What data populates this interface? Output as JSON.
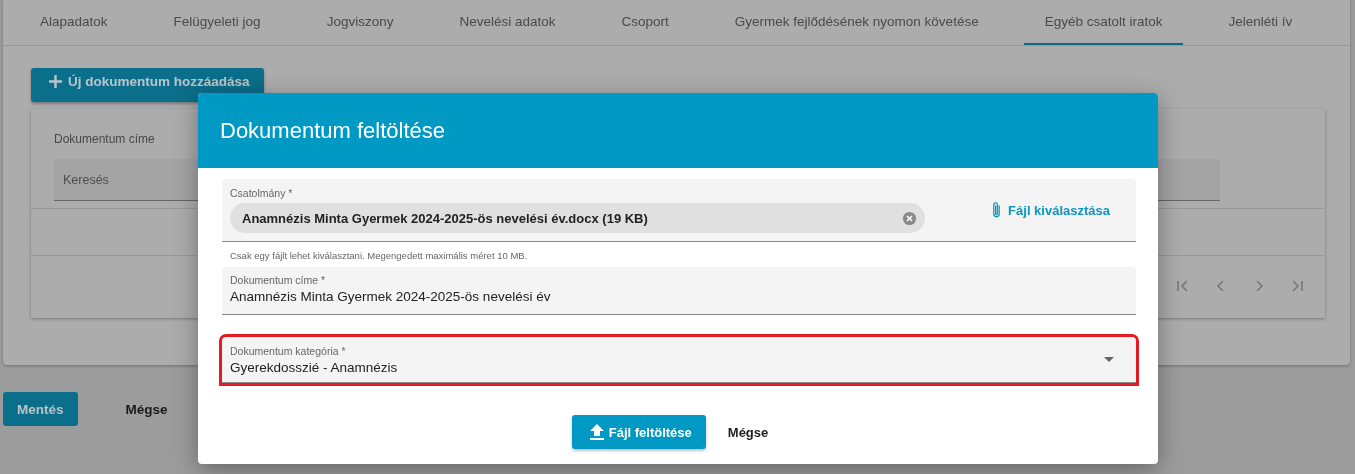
{
  "tabs": [
    {
      "label": "Alapadatok",
      "selected": false
    },
    {
      "label": "Felügyeleti jog",
      "selected": false
    },
    {
      "label": "Jogviszony",
      "selected": false
    },
    {
      "label": "Nevelési adatok",
      "selected": false
    },
    {
      "label": "Csoport",
      "selected": false
    },
    {
      "label": "Gyermek fejlődésének nyomon követése",
      "selected": false
    },
    {
      "label": "Egyéb csatolt iratok",
      "selected": true
    },
    {
      "label": "Jelenléti ív",
      "selected": false
    }
  ],
  "add_button": {
    "label": "Új dokumentum hozzáadása"
  },
  "table": {
    "columns": [
      "Dokumentum címe"
    ],
    "search": {
      "placeholder": "Keresés"
    }
  },
  "footer_buttons": [
    {
      "label": "Mentés",
      "kind": "primary"
    },
    {
      "label": "Mégse",
      "kind": "text"
    }
  ],
  "dialog": {
    "title": "Dokumentum feltöltése",
    "attachment": {
      "label": "Csatolmány *",
      "file": "Anamnézis Minta Gyermek 2024-2025-ös nevelési év.docx (19 KB)",
      "choose": "Fájl kiválasztása",
      "hint": "Csak egy fájlt lehet kiválasztani. Megengedett maximális méret 10 MB."
    },
    "title_field": {
      "label": "Dokumentum címe *",
      "value": "Anamnézis Minta Gyermek 2024-2025-ös nevelési év"
    },
    "category_field": {
      "label": "Dokumentum kategória *",
      "value": "Gyerekdosszié - Anamnézis",
      "highlighted": true
    },
    "buttons": [
      {
        "label": "Fájl feltöltése",
        "kind": "primary"
      },
      {
        "label": "Mégse",
        "kind": "text"
      }
    ]
  }
}
